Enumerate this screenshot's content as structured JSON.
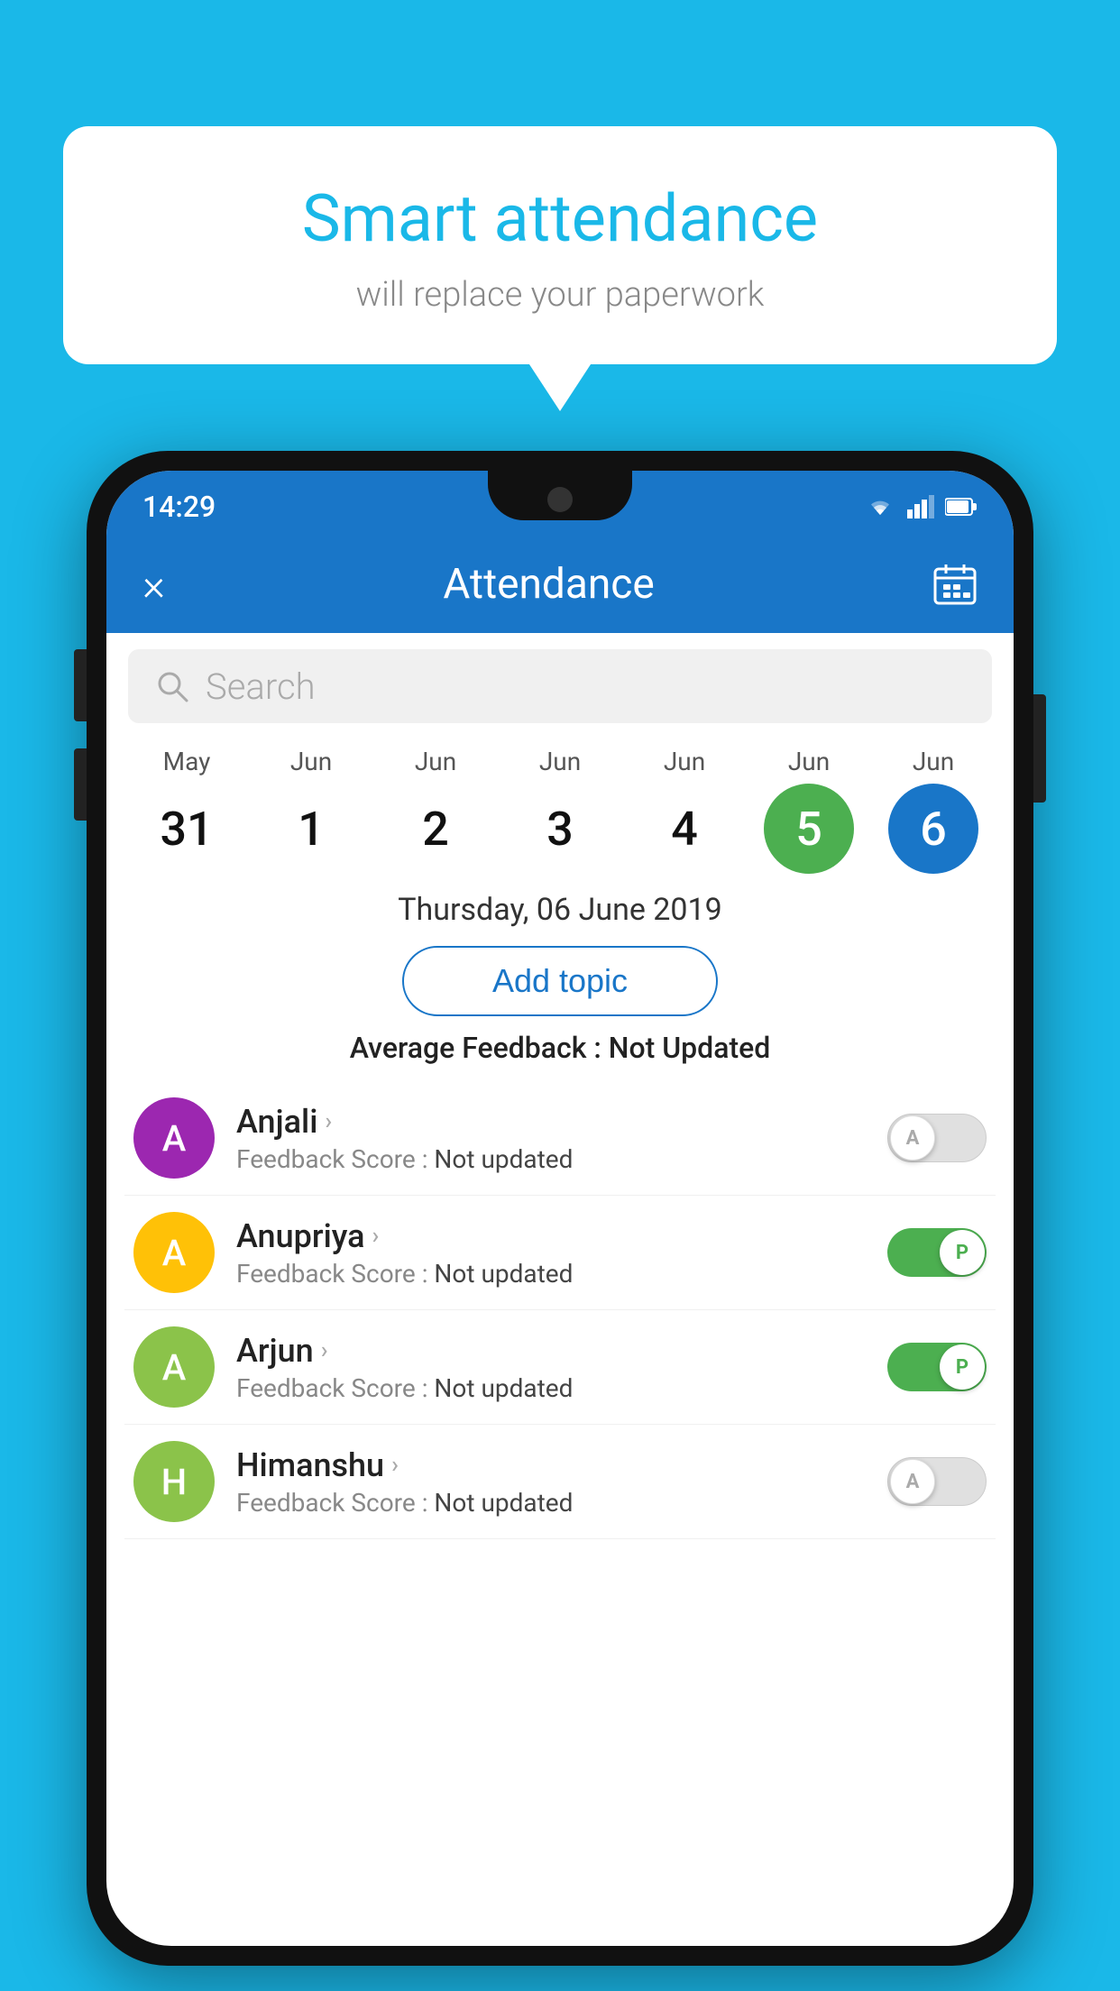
{
  "background_color": "#1ab8e8",
  "speech_bubble": {
    "title": "Smart attendance",
    "subtitle": "will replace your paperwork"
  },
  "status_bar": {
    "time": "14:29",
    "icons": [
      "wifi",
      "signal",
      "battery"
    ]
  },
  "app_bar": {
    "title": "Attendance",
    "close_label": "×",
    "calendar_icon": "📅"
  },
  "search": {
    "placeholder": "Search"
  },
  "dates": [
    {
      "month": "May",
      "day": "31",
      "active": ""
    },
    {
      "month": "Jun",
      "day": "1",
      "active": ""
    },
    {
      "month": "Jun",
      "day": "2",
      "active": ""
    },
    {
      "month": "Jun",
      "day": "3",
      "active": ""
    },
    {
      "month": "Jun",
      "day": "4",
      "active": ""
    },
    {
      "month": "Jun",
      "day": "5",
      "active": "green"
    },
    {
      "month": "Jun",
      "day": "6",
      "active": "blue"
    }
  ],
  "selected_date": "Thursday, 06 June 2019",
  "add_topic_label": "Add topic",
  "avg_feedback_label": "Average Feedback :",
  "avg_feedback_value": "Not Updated",
  "students": [
    {
      "name": "Anjali",
      "avatar_letter": "A",
      "avatar_color": "#9c27b0",
      "feedback_label": "Feedback Score :",
      "feedback_value": "Not updated",
      "toggle": "off",
      "toggle_letter": "A"
    },
    {
      "name": "Anupriya",
      "avatar_letter": "A",
      "avatar_color": "#ffc107",
      "feedback_label": "Feedback Score :",
      "feedback_value": "Not updated",
      "toggle": "on",
      "toggle_letter": "P"
    },
    {
      "name": "Arjun",
      "avatar_letter": "A",
      "avatar_color": "#8bc34a",
      "feedback_label": "Feedback Score :",
      "feedback_value": "Not updated",
      "toggle": "on",
      "toggle_letter": "P"
    },
    {
      "name": "Himanshu",
      "avatar_letter": "H",
      "avatar_color": "#8bc34a",
      "feedback_label": "Feedback Score :",
      "feedback_value": "Not updated",
      "toggle": "off",
      "toggle_letter": "A"
    }
  ]
}
